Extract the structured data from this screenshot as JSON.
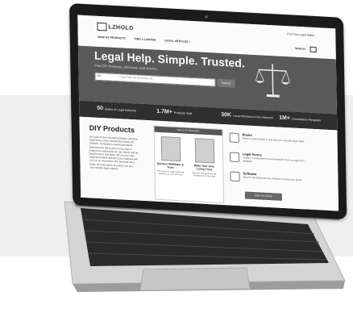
{
  "site": {
    "logo": "LZHOLD",
    "nav": [
      "SHOP BY PRODUCTS",
      "FIND A LAWYER",
      "LEGAL ARTICLES +"
    ],
    "utility": "Find Your Legal Matter",
    "signin": "SIGN IN"
  },
  "hero": {
    "title": "Legal Help. Simple. Trusted.",
    "subtitle": "Find DIY Products, attorneys, and articles.",
    "search_select": "All",
    "search_placeholder": "Legal help for Everyday life...",
    "search_button": "Search"
  },
  "stats": [
    {
      "value": "50",
      "label": "States of Legal Authority"
    },
    {
      "value": "1.7M+",
      "label": "Products Sold"
    },
    {
      "value": "30K",
      "label": "Local Attorneys in Our Network"
    },
    {
      "value": "1M+",
      "label": "Consultation Requests"
    }
  ],
  "diy": {
    "title": "DIY Products",
    "text": "Our suite of do-it-yourself products, including legal forms, online documents, books and software. Complete a customized estate planning form like a will or living trust or prepare an estate plan for your family. Get all legal forms in one place. Fill out your own legal documents and start your business with an LLC or corporation. Our products are a great, low-cost option to protect you and your family's legal matters."
  },
  "products": {
    "title": "Nolo's #1 Bestseller",
    "items": [
      {
        "name": "Quicken WillMaker & Trust",
        "desc": "The leader in estate planning software, for over 30 years"
      },
      {
        "name": "Make Your Own Living Trust",
        "desc": "Step-by-step guidance for creating your living trust"
      }
    ]
  },
  "sidebar": {
    "items": [
      {
        "title": "Books",
        "desc": "Written in plain English to help with your everyday legal needs."
      },
      {
        "title": "Legal Forms",
        "desc": "Create a customized form and download it from our legal form database."
      },
      {
        "title": "Software",
        "desc": "Easy-to-use estate planning software to protect your family."
      }
    ],
    "button": "Visit Our Store"
  }
}
